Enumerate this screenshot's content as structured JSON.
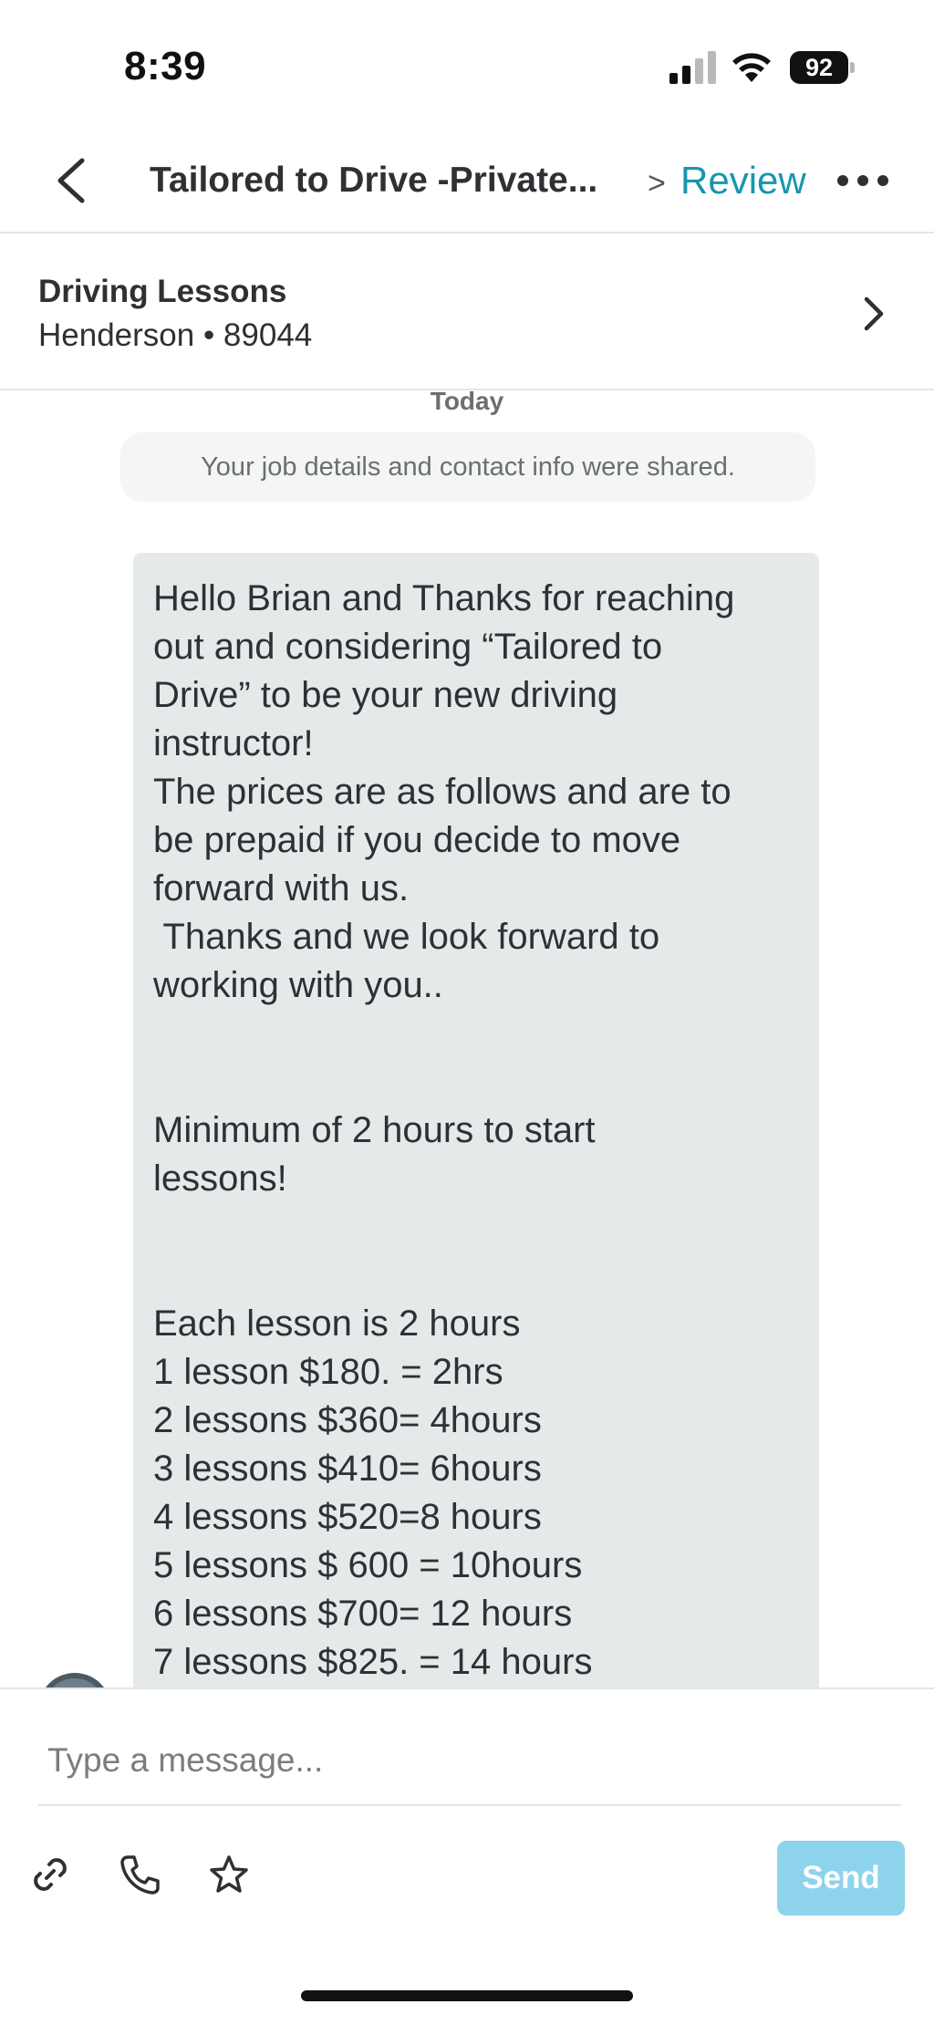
{
  "status_bar": {
    "time": "8:39",
    "battery": "92"
  },
  "header": {
    "title": "Tailored to Drive -Private...",
    "chevron": ">",
    "review_label": "Review"
  },
  "job": {
    "title": "Driving Lessons",
    "location": "Henderson • 89044"
  },
  "conversation": {
    "date_label": "Today",
    "system_note": "Your job details and contact info were shared.",
    "message_lines": [
      "Hello Brian and Thanks for reaching",
      "out and considering “Tailored to",
      "Drive” to be your new driving",
      "instructor!",
      "The prices are as follows and are to",
      "be prepaid if you decide to move",
      "forward with us.",
      " Thanks and we look forward to",
      "working with you..",
      "",
      "",
      "Minimum of 2 hours to start",
      "lessons!",
      "",
      "",
      "Each lesson is 2 hours",
      "1 lesson $180. = 2hrs",
      "2 lessons $360= 4hours",
      "3 lessons $410= 6hours",
      "4 lessons $520=8 hours",
      "5 lessons $ 600 = 10hours",
      "6 lessons $700= 12 hours",
      "7 lessons $825. = 14 hours"
    ]
  },
  "composer": {
    "placeholder": "Type a message...",
    "send_label": "Send"
  },
  "icons": {
    "back": "chevron-left-icon",
    "more": "more-horizontal-icon",
    "job_chevron": "chevron-right-icon",
    "attach": "link-icon",
    "phone": "phone-icon",
    "star": "star-icon"
  },
  "colors": {
    "accent": "#1796b0",
    "send_button": "#8ed3ec",
    "bubble": "#e6e9ea"
  }
}
